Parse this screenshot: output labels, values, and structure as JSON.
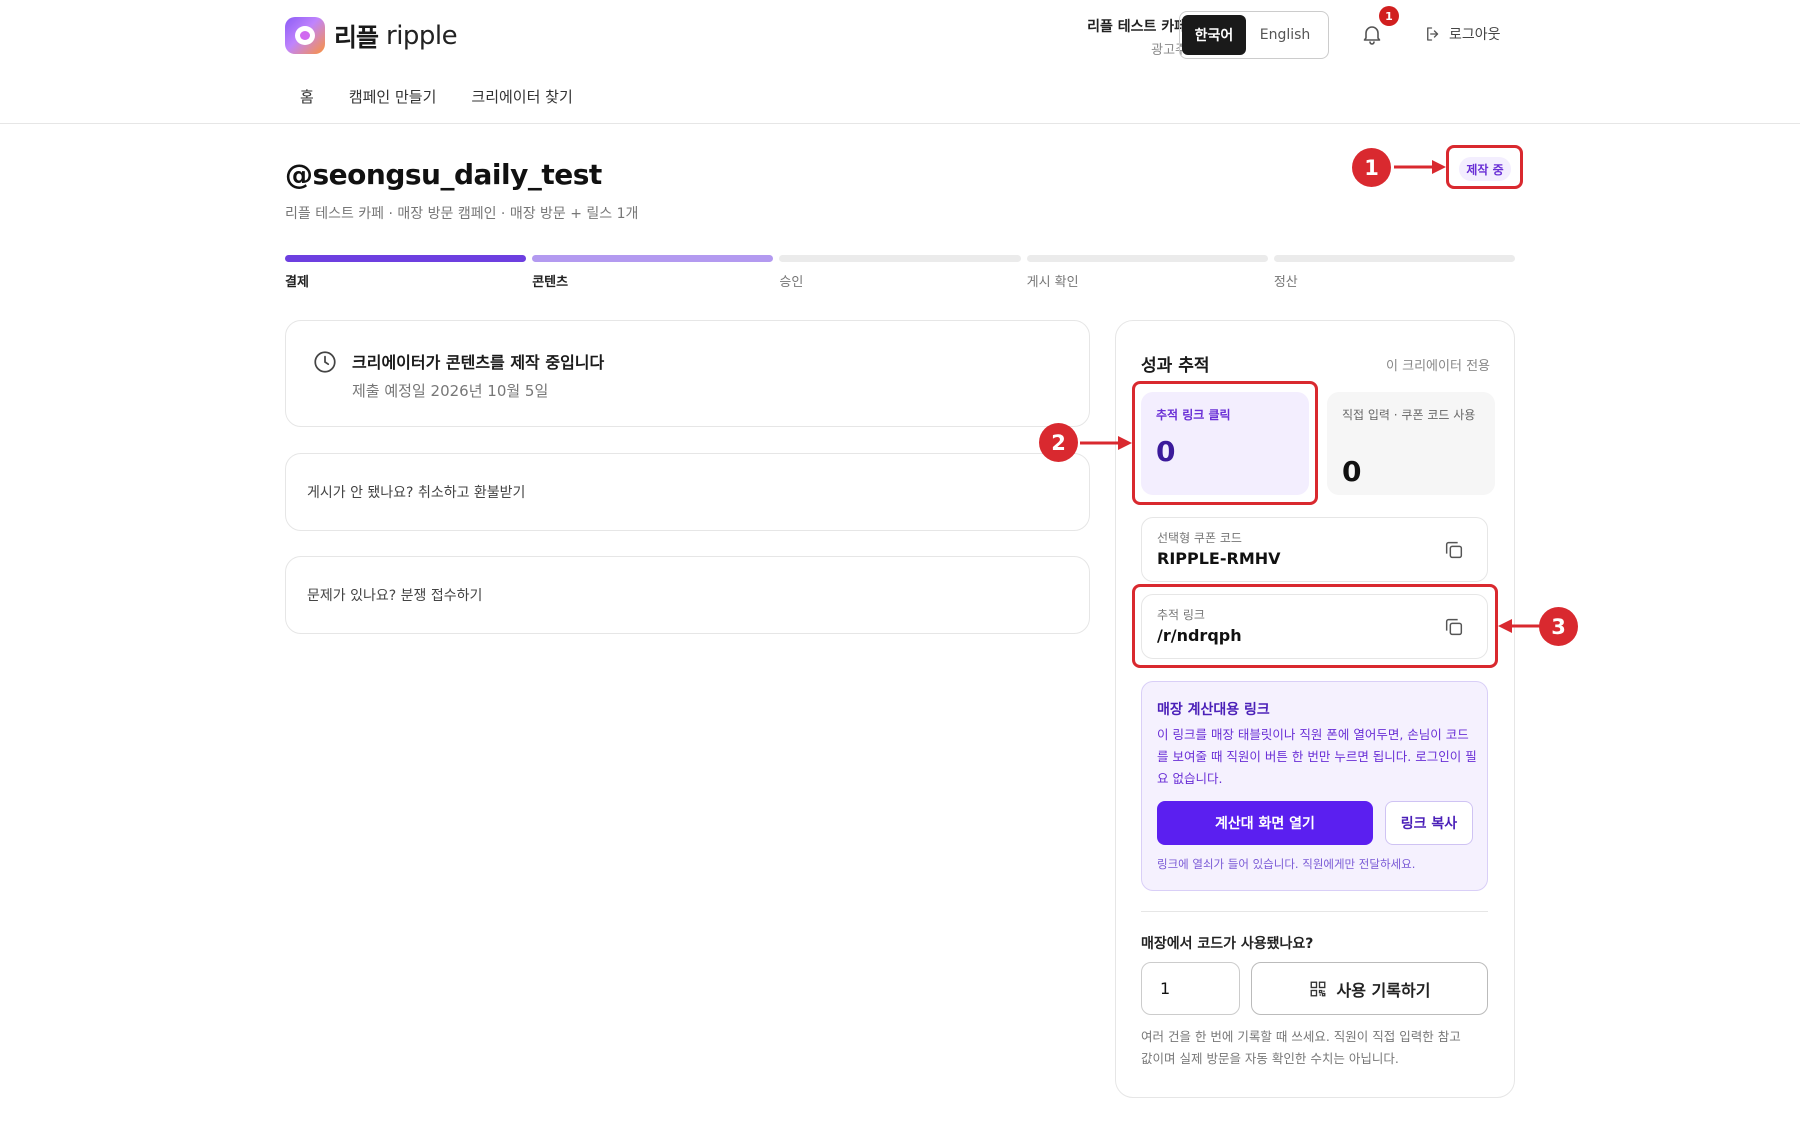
{
  "header": {
    "logo_ko": "리플",
    "logo_en": "ripple",
    "account_name": "리플 테스트 카페",
    "account_role": "광고주",
    "lang_active": "한국어",
    "lang_inactive": "English",
    "notification_count": "1",
    "logout_label": "로그아웃"
  },
  "nav": {
    "items": [
      "홈",
      "캠페인 만들기",
      "크리에이터 찾기"
    ]
  },
  "campaign": {
    "handle": "@seongsu_daily_test",
    "subtitle": "리플 테스트 카페 · 매장 방문 캠페인 · 매장 방문 + 릴스 1개",
    "status": "제작 중"
  },
  "steps": [
    {
      "label": "결제",
      "state": "done"
    },
    {
      "label": "콘텐츠",
      "state": "current"
    },
    {
      "label": "승인",
      "state": "pending"
    },
    {
      "label": "게시 확인",
      "state": "pending"
    },
    {
      "label": "정산",
      "state": "pending"
    }
  ],
  "status_card": {
    "title": "크리에이터가 콘텐츠를 제작 중입니다",
    "date": "제출 예정일 2026년 10월 5일"
  },
  "links": {
    "cancel": "게시가 안 됐나요? 취소하고 환불받기",
    "dispute": "문제가 있나요? 분쟁 접수하기"
  },
  "tracking": {
    "title": "성과 추적",
    "note": "이 크리에이터 전용",
    "clicks_label": "추적 링크 클릭",
    "clicks_value": "0",
    "direct_label": "직접 입력 · 쿠폰 코드 사용",
    "direct_value": "0",
    "coupon_label": "선택형 쿠폰 코드",
    "coupon_value": "RIPPLE-RMHV",
    "link_label": "추적 링크",
    "link_value": "/r/ndrqph"
  },
  "pos": {
    "title": "매장 계산대용 링크",
    "description": "이 링크를 매장 태블릿이나 직원 폰에 열어두면, 손님이 코드를 보여줄 때 직원이 버튼 한 번만 누르면 됩니다. 로그인이 필요 없습니다.",
    "open_button": "계산대 화면 열기",
    "copy_button": "링크 복사",
    "note": "링크에 열쇠가 들어 있습니다. 직원에게만 전달하세요."
  },
  "usage": {
    "question": "매장에서 코드가 사용됐나요?",
    "quantity": "1",
    "record_button": "사용 기록하기",
    "help": "여러 건을 한 번에 기록할 때 쓰세요. 직원이 직접 입력한 참고값이며 실제 방문을 자동 확인한 수치는 아닙니다."
  },
  "annotations": [
    "1",
    "2",
    "3"
  ],
  "colors": {
    "accent": "#5b1ff0",
    "annotation": "#d9292f",
    "progress_done": "#6d3fe0",
    "progress_current": "#b39af0"
  }
}
